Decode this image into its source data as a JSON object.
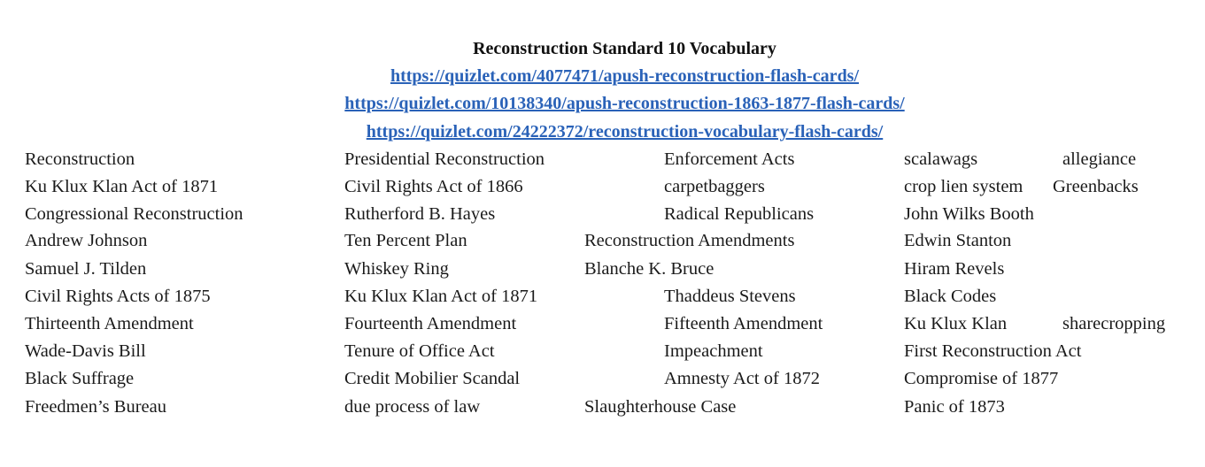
{
  "document": {
    "title": "Reconstruction Standard 10 Vocabulary",
    "links": [
      "https://quizlet.com/4077471/apush-reconstruction-flash-cards/",
      "https://quizlet.com/10138340/apush-reconstruction-1863-1877-flash-cards/",
      "https://quizlet.com/24222372/reconstruction-vocabulary-flash-cards/"
    ],
    "rows": [
      [
        "Reconstruction",
        "Presidential Reconstruction",
        "Enforcement Acts",
        "scalawags",
        "allegiance"
      ],
      [
        "Ku Klux Klan Act of 1871",
        "Civil Rights Act of 1866",
        "carpetbaggers",
        "crop lien system",
        "Greenbacks"
      ],
      [
        "Congressional Reconstruction",
        "Rutherford B. Hayes",
        "Radical Republicans",
        "John Wilks Booth"
      ],
      [
        "Andrew Johnson",
        "Ten Percent Plan",
        "Reconstruction Amendments",
        "Edwin Stanton"
      ],
      [
        "Samuel J. Tilden",
        "Whiskey Ring",
        "Blanche K. Bruce",
        "Hiram Revels"
      ],
      [
        "Civil Rights Acts of 1875",
        "Ku Klux Klan Act of 1871",
        "Thaddeus Stevens",
        "Black Codes"
      ],
      [
        "Thirteenth Amendment",
        "Fourteenth Amendment",
        "Fifteenth Amendment",
        "Ku Klux Klan",
        "sharecropping"
      ],
      [
        "Wade-Davis Bill",
        "Tenure of Office Act",
        "Impeachment",
        "First Reconstruction Act"
      ],
      [
        "Black Suffrage",
        "Credit Mobilier Scandal",
        "Amnesty Act of 1872",
        "Compromise of 1877"
      ],
      [
        "Freedmen’s Bureau",
        "due process of law",
        "Slaughterhouse Case",
        "Panic of 1873"
      ]
    ]
  }
}
